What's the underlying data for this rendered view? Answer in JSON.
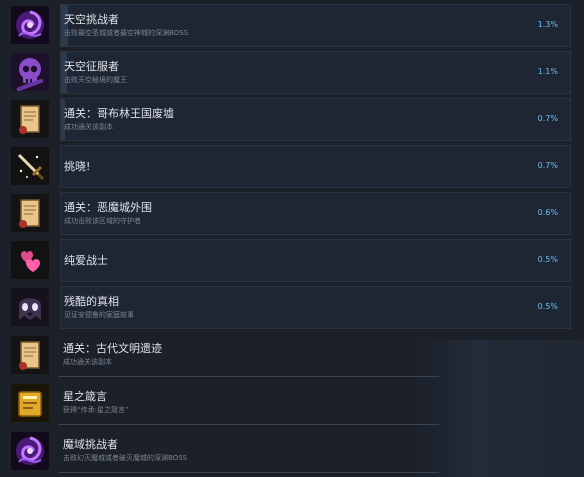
{
  "achievements": [
    {
      "title": "天空挑战者",
      "desc": "击败最空圣城或者最空神城的深渊BOSS",
      "pct": "1.3%",
      "icon": "purple-vortex-icon",
      "progress": 0.013
    },
    {
      "title": "天空征服者",
      "desc": "击败天空秘境的魔王",
      "pct": "1.1%",
      "icon": "skull-icon",
      "progress": 0.011
    },
    {
      "title": "通关：哥布林王国废墟",
      "desc": "成功通关该副本",
      "pct": "0.7%",
      "icon": "scroll-icon",
      "progress": 0.007
    },
    {
      "title": "挑晓!",
      "desc": "",
      "pct": "0.7%",
      "icon": "sword-icon",
      "progress": 0.007
    },
    {
      "title": "通关：恶魔城外围",
      "desc": "成功击败该区域的守护者",
      "pct": "0.6%",
      "icon": "scroll-icon",
      "progress": 0.006
    },
    {
      "title": "纯爱战士",
      "desc": "",
      "pct": "0.5%",
      "icon": "hearts-icon",
      "progress": 0.005
    },
    {
      "title": "残酷的真相",
      "desc": "见证安德鲁的家庭故事",
      "pct": "0.5%",
      "icon": "ghost-icon",
      "progress": 0.005
    },
    {
      "title": "通关：古代文明遗迹",
      "desc": "成功通关该副本",
      "pct": "",
      "icon": "scroll-icon",
      "progress": 0
    },
    {
      "title": "星之箴言",
      "desc": "获得“传承:星之箴言”",
      "pct": "",
      "icon": "golden-book-icon",
      "progress": 0
    },
    {
      "title": "魔域挑战者",
      "desc": "击败幻灭魔城或者破灭魔城的深渊BOSS",
      "pct": "",
      "icon": "purple-vortex-icon",
      "progress": 0
    }
  ],
  "colors": {
    "background": "#1b2029",
    "panel": "#1f2633",
    "title": "#dfe3e8",
    "desc": "#7b8594",
    "percent": "#66c0f4",
    "bar": "#2b3a4c"
  }
}
